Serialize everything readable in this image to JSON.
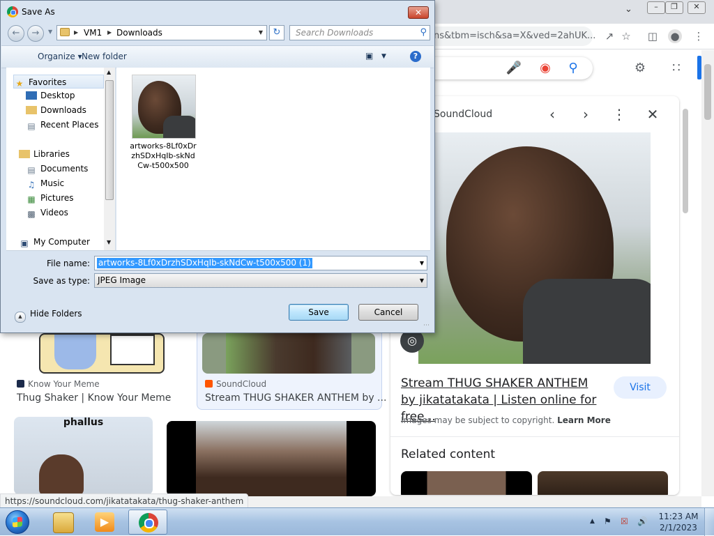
{
  "dialog": {
    "title": "Save As",
    "breadcrumb": [
      "VM1",
      "Downloads"
    ],
    "search_placeholder": "Search Downloads",
    "toolbar": {
      "organize": "Organize",
      "new_folder": "New folder"
    },
    "nav_tree": {
      "favorites": "Favorites",
      "desktop": "Desktop",
      "downloads": "Downloads",
      "recent_places": "Recent Places",
      "libraries": "Libraries",
      "documents": "Documents",
      "music": "Music",
      "pictures": "Pictures",
      "videos": "Videos",
      "my_computer": "My Computer"
    },
    "file": {
      "name": "artworks-8Lf0xDrzhSDxHqIb-skNdCw-t500x500"
    },
    "file_name_label": "File name:",
    "file_name_value": "artworks-8Lf0xDrzhSDxHqIb-skNdCw-t500x500 (1)",
    "save_type_label": "Save as type:",
    "save_type_value": "JPEG Image",
    "hide_folders": "Hide Folders",
    "save_button": "Save",
    "cancel_button": "Cancel"
  },
  "browser": {
    "url_fragment": "ns&tbm=isch&sa=X&ved=2ahUK...",
    "panel": {
      "source": "SoundCloud",
      "title": "Stream THUG SHAKER ANTHEM by jikatatakata | Listen online for free...",
      "visit": "Visit",
      "copyright_text": "Images may be subject to copyright.",
      "learn_more": "Learn More",
      "related": "Related content"
    },
    "results": [
      {
        "source": "Know Your Meme",
        "title": "Thug Shaker | Know Your Meme"
      },
      {
        "source": "SoundCloud",
        "title": "Stream THUG SHAKER ANTHEM by ..."
      }
    ],
    "thumb_caption": "phallus",
    "status_url": "https://soundcloud.com/jikatatakata/thug-shaker-anthem"
  },
  "taskbar": {
    "time": "11:23 AM",
    "date": "2/1/2023"
  }
}
